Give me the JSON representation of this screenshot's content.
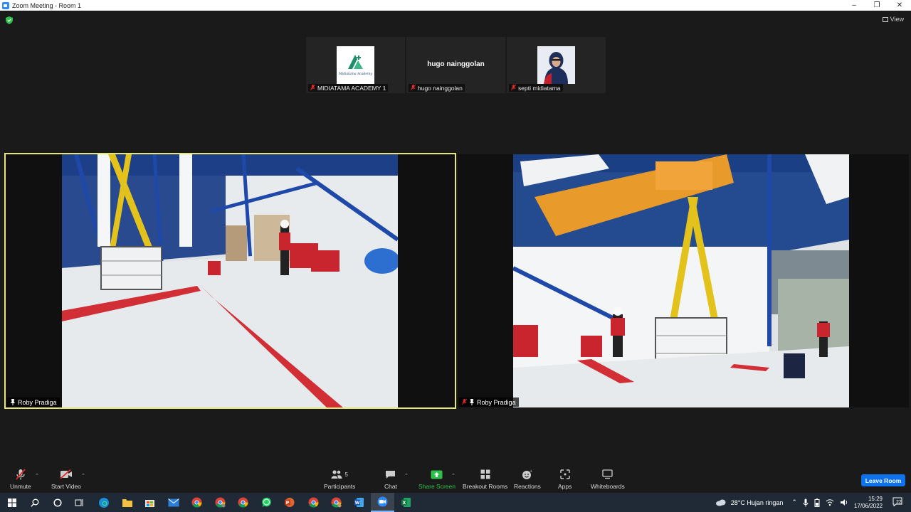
{
  "window": {
    "title": "Zoom Meeting - Room 1",
    "controls": [
      "minimize-icon",
      "restore-icon",
      "close-icon"
    ]
  },
  "header": {
    "view_label": "View"
  },
  "gallery": [
    {
      "name": "MIDIATAMA ACADEMY 1",
      "thumb": "logo",
      "logo_text": "Midiatama Academy",
      "muted": true
    },
    {
      "name": "hugo nainggolan",
      "display_name": "hugo nainggolan",
      "thumb": "text",
      "muted": true
    },
    {
      "name": "septi midiatama",
      "thumb": "photo",
      "muted": true
    }
  ],
  "videos": [
    {
      "name": "Roby Pradiga",
      "pinned": true,
      "active_speaker": true,
      "muted": false
    },
    {
      "name": "Roby Pradiga",
      "pinned": true,
      "active_speaker": false,
      "muted": true
    }
  ],
  "toolbar": {
    "unmute": "Unmute",
    "start_video": "Start Video",
    "participants": "Participants",
    "participants_count": "5",
    "chat": "Chat",
    "share_screen": "Share Screen",
    "breakout_rooms": "Breakout Rooms",
    "reactions": "Reactions",
    "apps": "Apps",
    "whiteboards": "Whiteboards",
    "leave_room": "Leave Room"
  },
  "colors": {
    "active_border": "#e5e67a",
    "share_green": "#2ec24a",
    "leave_blue": "#0e72ed",
    "muted_red": "#e02828"
  },
  "taskbar": {
    "apps": [
      "windows-start-icon",
      "search-icon",
      "cortana-icon",
      "task-view-icon",
      "edge-icon",
      "file-explorer-icon",
      "store-icon",
      "mail-icon",
      "chrome-icon",
      "chrome-icon",
      "chrome-icon",
      "whatsapp-icon",
      "powerpoint-icon",
      "chrome-icon",
      "chrome-icon",
      "word-icon",
      "zoom-icon",
      "excel-icon"
    ],
    "weather": "28°C  Hujan ringan",
    "time": "15:29",
    "date": "17/06/2022",
    "notifications": "22"
  }
}
